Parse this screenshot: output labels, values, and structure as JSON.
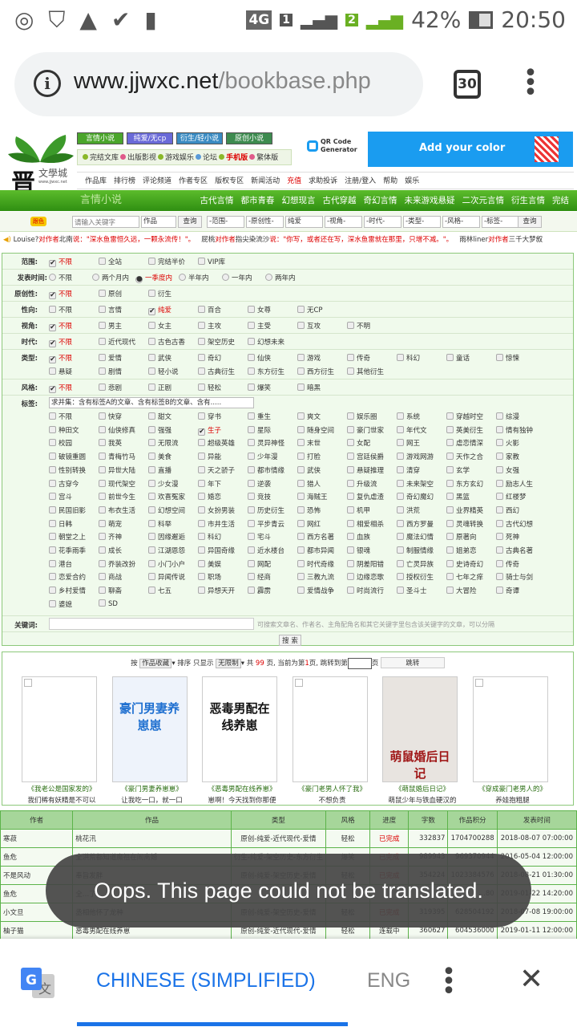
{
  "status": {
    "time": "20:50",
    "battery": "42%",
    "network": "4G",
    "sim1": "1",
    "sim2": "2",
    "icons": [
      "whatsapp-icon",
      "shield-icon",
      "warning-icon",
      "check-icon",
      "sd-card-icon"
    ]
  },
  "browser": {
    "url_domain": "www.jjwxc.net",
    "url_path": "/bookbase.php",
    "tab_count": "30"
  },
  "site": {
    "top_buttons": [
      {
        "label": "言情小说",
        "color": "#4aa52b"
      },
      {
        "label": "纯爱/无cp",
        "color": "#6a6ad8"
      },
      {
        "label": "衍生/轻小说",
        "color": "#3a8bc2"
      },
      {
        "label": "原创小说",
        "color": "#3d8b4f"
      }
    ],
    "sub_links": [
      "完结文库",
      "出版影视",
      "游戏娱乐",
      "论坛",
      "手机版",
      "繁体版"
    ],
    "logo_text": "文學城",
    "logo_url": "www.jjwxc.net",
    "ad": {
      "qr_title": "QR Code",
      "qr_sub": "Generator",
      "slogan": "Add your color"
    },
    "nav": [
      "作品库",
      "排行榜",
      "评论频道",
      "作者专区",
      "版权专区",
      "新闻活动",
      "充值",
      "求助投诉",
      "注册/登入",
      "帮助",
      "娱乐"
    ],
    "channel": "言情小说",
    "categories": [
      "古代言情",
      "都市青春",
      "幻想现言",
      "古代穿越",
      "奇幻言情",
      "未来游戏悬疑",
      "二次元言情",
      "衍生言情",
      "完结"
    ],
    "search": {
      "badge": "跟色",
      "placeholder": "请输入关键字",
      "type": "作品",
      "button": "查询",
      "selects": [
        "-范围-",
        "-原创性-",
        "纯爱",
        "-视角-",
        "-时代-",
        "-类型-",
        "-风格-",
        "-标签-"
      ],
      "button2": "查询"
    },
    "ticker": [
      {
        "user": "Louise?",
        "to": "对作者",
        "author": "北南",
        "said": "说：",
        "msg": "\"深水鱼雷恒久远，一颗永流传！\"。"
      },
      {
        "user": "屁桃",
        "to": "对作者",
        "author": "指尖染流沙",
        "said": "说：",
        "msg": "\"你写，或者还在写，深水鱼雷就在那里，只增不减。\"。"
      },
      {
        "user": "雨林liner",
        "to": "对作者",
        "author": "三千大梦叙",
        "said": "",
        "msg": ""
      }
    ]
  },
  "filters": [
    {
      "label": "范围:",
      "type": "checkbox",
      "options": [
        [
          "不限",
          1
        ],
        [
          "全站",
          0
        ],
        [
          "完结半价",
          0
        ],
        [
          "VIP库",
          0
        ]
      ]
    },
    {
      "label": "发表时间:",
      "type": "radio",
      "options": [
        [
          "不限",
          0
        ],
        [
          "两个月内",
          0
        ],
        [
          "一季度内",
          1
        ],
        [
          "半年内",
          0
        ],
        [
          "一年内",
          0
        ],
        [
          "两年内",
          0
        ]
      ]
    },
    {
      "label": "原创性:",
      "type": "checkbox",
      "options": [
        [
          "不限",
          1
        ],
        [
          "原创",
          0
        ],
        [
          "衍生",
          0
        ]
      ]
    },
    {
      "label": "性向:",
      "type": "checkbox",
      "options": [
        [
          "不限",
          0
        ],
        [
          "言情",
          0
        ],
        [
          "纯爱",
          1
        ],
        [
          "百合",
          0
        ],
        [
          "女尊",
          0
        ],
        [
          "无CP",
          0
        ]
      ]
    },
    {
      "label": "视角:",
      "type": "checkbox",
      "options": [
        [
          "不限",
          1
        ],
        [
          "男主",
          0
        ],
        [
          "女主",
          0
        ],
        [
          "主攻",
          0
        ],
        [
          "主受",
          0
        ],
        [
          "互攻",
          0
        ],
        [
          "不明",
          0
        ]
      ]
    },
    {
      "label": "时代:",
      "type": "checkbox",
      "options": [
        [
          "不限",
          1
        ],
        [
          "近代现代",
          0
        ],
        [
          "古色古香",
          0
        ],
        [
          "架空历史",
          0
        ],
        [
          "幻想未来",
          0
        ]
      ]
    },
    {
      "label": "类型:",
      "type": "checkbox",
      "options": [
        [
          "不限",
          1
        ],
        [
          "爱情",
          0
        ],
        [
          "武侠",
          0
        ],
        [
          "奇幻",
          0
        ],
        [
          "仙侠",
          0
        ],
        [
          "游戏",
          0
        ],
        [
          "传奇",
          0
        ],
        [
          "科幻",
          0
        ],
        [
          "童话",
          0
        ],
        [
          "惊悚",
          0
        ],
        [
          "悬疑",
          0
        ],
        [
          "剧情",
          0
        ],
        [
          "轻小说",
          0
        ],
        [
          "古典衍生",
          0
        ],
        [
          "东方衍生",
          0
        ],
        [
          "西方衍生",
          0
        ],
        [
          "其他衍生",
          0
        ]
      ]
    },
    {
      "label": "风格:",
      "type": "checkbox",
      "options": [
        [
          "不限",
          1
        ],
        [
          "悲剧",
          0
        ],
        [
          "正剧",
          0
        ],
        [
          "轻松",
          0
        ],
        [
          "爆笑",
          0
        ],
        [
          "暗黑",
          0
        ]
      ]
    }
  ],
  "tags": {
    "label": "标签:",
    "mode": "求并集：含有标签A的文章、含有标签B的文章、含有.....",
    "options": [
      [
        "不限",
        0
      ],
      [
        "快穿",
        0
      ],
      [
        "甜文",
        0
      ],
      [
        "穿书",
        0
      ],
      [
        "重生",
        0
      ],
      [
        "爽文",
        0
      ],
      [
        "娱乐圈",
        0
      ],
      [
        "系统",
        0
      ],
      [
        "穿越时空",
        0
      ],
      [
        "综漫",
        0
      ],
      [
        "种田文",
        0
      ],
      [
        "仙侠修真",
        0
      ],
      [
        "强强",
        0
      ],
      [
        "生子",
        1
      ],
      [
        "星际",
        0
      ],
      [
        "随身空间",
        0
      ],
      [
        "豪门世家",
        0
      ],
      [
        "年代文",
        0
      ],
      [
        "英美衍生",
        0
      ],
      [
        "情有独钟",
        0
      ],
      [
        "校园",
        0
      ],
      [
        "我英",
        0
      ],
      [
        "无限流",
        0
      ],
      [
        "超级英雄",
        0
      ],
      [
        "灵异神怪",
        0
      ],
      [
        "末世",
        0
      ],
      [
        "女配",
        0
      ],
      [
        "网王",
        0
      ],
      [
        "虐恋情深",
        0
      ],
      [
        "火影",
        0
      ],
      [
        "破镜重圆",
        0
      ],
      [
        "青梅竹马",
        0
      ],
      [
        "美食",
        0
      ],
      [
        "异能",
        0
      ],
      [
        "少年漫",
        0
      ],
      [
        "打脸",
        0
      ],
      [
        "宫廷侯爵",
        0
      ],
      [
        "游戏网游",
        0
      ],
      [
        "天作之合",
        0
      ],
      [
        "家教",
        0
      ],
      [
        "性别转换",
        0
      ],
      [
        "异世大陆",
        0
      ],
      [
        "直播",
        0
      ],
      [
        "天之骄子",
        0
      ],
      [
        "都市情缘",
        0
      ],
      [
        "武侠",
        0
      ],
      [
        "悬疑推理",
        0
      ],
      [
        "清穿",
        0
      ],
      [
        "玄学",
        0
      ],
      [
        "女强",
        0
      ],
      [
        "古穿今",
        0
      ],
      [
        "现代架空",
        0
      ],
      [
        "少女漫",
        0
      ],
      [
        "年下",
        0
      ],
      [
        "逆袭",
        0
      ],
      [
        "猎人",
        0
      ],
      [
        "升级流",
        0
      ],
      [
        "未来架空",
        0
      ],
      [
        "东方玄幻",
        0
      ],
      [
        "励志人生",
        0
      ],
      [
        "宫斗",
        0
      ],
      [
        "前世今生",
        0
      ],
      [
        "欢喜冤家",
        0
      ],
      [
        "婚恋",
        0
      ],
      [
        "竞技",
        0
      ],
      [
        "海贼王",
        0
      ],
      [
        "复仇虐渣",
        0
      ],
      [
        "奇幻魔幻",
        0
      ],
      [
        "黑篮",
        0
      ],
      [
        "红楼梦",
        0
      ],
      [
        "民国旧影",
        0
      ],
      [
        "布衣生活",
        0
      ],
      [
        "幻想空间",
        0
      ],
      [
        "女扮男装",
        0
      ],
      [
        "历史衍生",
        0
      ],
      [
        "恐怖",
        0
      ],
      [
        "机甲",
        0
      ],
      [
        "洪荒",
        0
      ],
      [
        "业界精英",
        0
      ],
      [
        "西幻",
        0
      ],
      [
        "日韩",
        0
      ],
      [
        "萌宠",
        0
      ],
      [
        "科举",
        0
      ],
      [
        "市井生活",
        0
      ],
      [
        "平步青云",
        0
      ],
      [
        "网红",
        0
      ],
      [
        "相爱相杀",
        0
      ],
      [
        "西方罗曼",
        0
      ],
      [
        "灵魂转换",
        0
      ],
      [
        "古代幻想",
        0
      ],
      [
        "朝堂之上",
        0
      ],
      [
        "齐神",
        0
      ],
      [
        "因缘邂逅",
        0
      ],
      [
        "科幻",
        0
      ],
      [
        "宅斗",
        0
      ],
      [
        "西方名著",
        0
      ],
      [
        "血族",
        0
      ],
      [
        "魔法幻情",
        0
      ],
      [
        "原著向",
        0
      ],
      [
        "死神",
        0
      ],
      [
        "花季雨季",
        0
      ],
      [
        "成长",
        0
      ],
      [
        "江湖恩怨",
        0
      ],
      [
        "异国奇缘",
        0
      ],
      [
        "近水楼台",
        0
      ],
      [
        "都市异闻",
        0
      ],
      [
        "银魂",
        0
      ],
      [
        "制服情缘",
        0
      ],
      [
        "姐弟恋",
        0
      ],
      [
        "古典名著",
        0
      ],
      [
        "港台",
        0
      ],
      [
        "乔装改扮",
        0
      ],
      [
        "小门小户",
        0
      ],
      [
        "美娱",
        0
      ],
      [
        "网配",
        0
      ],
      [
        "时代奇缘",
        0
      ],
      [
        "阴差阳错",
        0
      ],
      [
        "亡灵异族",
        0
      ],
      [
        "史诗奇幻",
        0
      ],
      [
        "传奇",
        0
      ],
      [
        "恋爱合约",
        0
      ],
      [
        "商战",
        0
      ],
      [
        "异闻传说",
        0
      ],
      [
        "职场",
        0
      ],
      [
        "经商",
        0
      ],
      [
        "三教九流",
        0
      ],
      [
        "边缘恋歌",
        0
      ],
      [
        "授权衍生",
        0
      ],
      [
        "七年之痒",
        0
      ],
      [
        "骑士与剑",
        0
      ],
      [
        "乡村爱情",
        0
      ],
      [
        "聊斋",
        0
      ],
      [
        "七五",
        0
      ],
      [
        "异想天开",
        0
      ],
      [
        "霹雳",
        0
      ],
      [
        "爱情战争",
        0
      ],
      [
        "时尚流行",
        0
      ],
      [
        "圣斗士",
        0
      ],
      [
        "大冒险",
        0
      ],
      [
        "奇谭",
        0
      ],
      [
        "婆媳",
        0
      ],
      [
        "SD",
        0
      ]
    ]
  },
  "keyword": {
    "label": "关键词:",
    "value": "",
    "hint": "可搜索文章名、作者名、主角配角名和其它关键字里包含该关键字的文章，可以分隔",
    "button": "搜 索"
  },
  "paging": {
    "by": "按",
    "sort": "作品收藏",
    "sort_suffix": "排序 只显示",
    "limit": "无限制",
    "total_pre": "共",
    "total": "99",
    "total_mid": "页, 当前为第",
    "current": "1",
    "current_suf": "页,",
    "jump_pre": "跳转到第",
    "jump_value": "",
    "jump_suf": "页",
    "jump_button": "跳转"
  },
  "books": [
    {
      "title": "《我老公是国家发的》",
      "desc": "我们稀有妖精是不可以",
      "cover": "blank"
    },
    {
      "title": "《豪门男妻养崽崽》",
      "desc": "让我吃一口，就一口",
      "cover": "豪门男妻养崽崽"
    },
    {
      "title": "《恶毒男配在线养崽》",
      "desc": "崽啊！今天找到你那便",
      "cover": "恶毒男配在线养崽"
    },
    {
      "title": "《豪门老男人怀了我》",
      "desc": "不想负责",
      "cover": "blank"
    },
    {
      "title": "《萌鼠婚后日记》",
      "desc": "萌鼠少年与铁血硬汉的",
      "cover": "萌鼠婚后日记"
    },
    {
      "title": "《穿成豪门老男人的》",
      "desc": "养娃抱粗腿",
      "cover": "blank"
    }
  ],
  "table": {
    "headers": [
      "作者",
      "作品",
      "类型",
      "风格",
      "进度",
      "字数",
      "作品积分",
      "发表时间"
    ],
    "rows": [
      [
        "寒菽",
        "桃花汛",
        "原创-纯爱-近代现代-爱情",
        "轻松",
        "已完成",
        "332837",
        "1704700288",
        "2018-08-07 07:00:00"
      ],
      [
        "鱼危",
        "全洪荒都知道魔祖在闹离婚",
        "衍生-纯爱-架空历史-东方衍生",
        "爆笑",
        "已完成",
        "989943",
        "969370944",
        "2016-05-04 12:00:00"
      ],
      [
        "不是风动",
        "奉旨发胖",
        "原创-纯爱-架空历史-爱情",
        "轻松",
        "已完成",
        "354224",
        "1023384576",
        "2018-08-21 01:30:00"
      ],
      [
        "鱼危",
        "全…了",
        "",
        "",
        "",
        "",
        "…80",
        "2019-01-22 14:20:00"
      ],
      [
        "小文旦",
        "丞相他怀了龙种",
        "原创-纯爱-架空历史-爱情",
        "轻松",
        "已完成",
        "319395",
        "628504192",
        "2018-07-08 19:00:00"
      ],
      [
        "柚子猫",
        "恶毒男配在线养崽",
        "原创-纯爱-近代现代-爱情",
        "轻松",
        "连载中",
        "360627",
        "604536000",
        "2019-01-11 12:00:00"
      ]
    ]
  },
  "toast": "Oops. This page could not be translated.",
  "translate_bar": {
    "source": "CHINESE (SIMPLIFIED)",
    "target": "ENG",
    "accent": "#1a73e8"
  }
}
